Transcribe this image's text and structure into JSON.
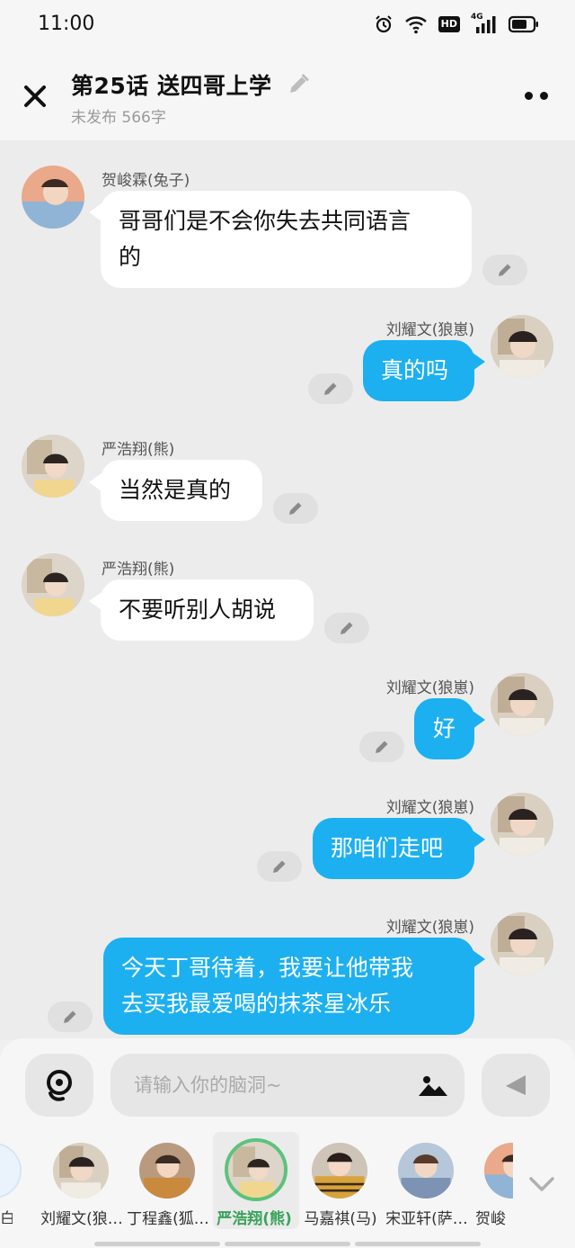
{
  "status": {
    "time": "11:00",
    "net_badge": "HD",
    "signal_label": "4G"
  },
  "header": {
    "title": "第25话   送四哥上学",
    "subtitle": "未发布 566字"
  },
  "messages": [
    {
      "side": "left",
      "name": "贺峻霖(兔子)",
      "lines": [
        "哥哥们是不会你失去共同语言",
        "的"
      ]
    },
    {
      "side": "right",
      "name": "刘耀文(狼崽)",
      "lines": [
        "真的吗"
      ]
    },
    {
      "side": "left",
      "name": "严浩翔(熊)",
      "lines": [
        "当然是真的"
      ]
    },
    {
      "side": "left",
      "name": "严浩翔(熊)",
      "lines": [
        "不要听别人胡说"
      ]
    },
    {
      "side": "right",
      "name": "刘耀文(狼崽)",
      "lines": [
        "好"
      ]
    },
    {
      "side": "right",
      "name": "刘耀文(狼崽)",
      "lines": [
        "那咱们走吧"
      ]
    },
    {
      "side": "right",
      "name": "刘耀文(狼崽)",
      "lines": [
        "今天丁哥待着，我要让他带我",
        "去买我最爱喝的抹茶星冰乐"
      ]
    }
  ],
  "input": {
    "placeholder": "请输入你的脑洞~"
  },
  "characters": [
    {
      "name": "刘耀文(狼崽)",
      "display": "刘耀文(狼…",
      "selected": false
    },
    {
      "name": "丁程鑫(狐狸)",
      "display": "丁程鑫(狐…",
      "selected": false
    },
    {
      "name": "严浩翔(熊)",
      "display": "严浩翔(熊)",
      "selected": true
    },
    {
      "name": "马嘉祺(马)",
      "display": "马嘉祺(马)",
      "selected": false
    },
    {
      "name": "宋亚轩(萨摩)",
      "display": "宋亚轩(萨…",
      "selected": false
    },
    {
      "name": "贺峻霖(兔子)",
      "display": "贺峻",
      "selected": false
    }
  ],
  "colors": {
    "accent_blue": "#1cb0f0",
    "selected_green": "#5cc27c",
    "background": "#ececec"
  }
}
